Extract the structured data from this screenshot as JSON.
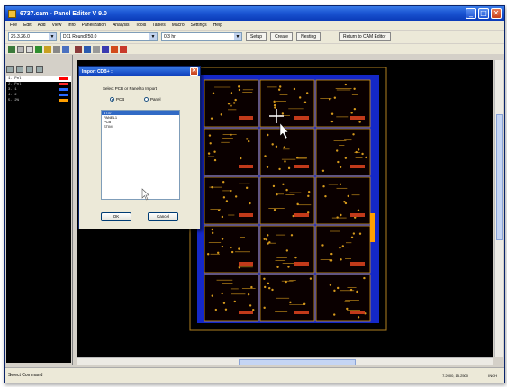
{
  "window": {
    "title": "6737.cam - Panel Editor V 9.0",
    "minimize": "_",
    "maximize": "□",
    "close": "✕"
  },
  "menu": [
    "File",
    "Edit",
    "Add",
    "View",
    "Info",
    "Panelization",
    "Analysis",
    "Tools",
    "Tables",
    "Macro",
    "Settings",
    "Help"
  ],
  "toolbar": {
    "combo1": "26.3.26.0",
    "combo2": "D11 Round250.0",
    "combo3": "0.3 hr",
    "buttons": [
      "Setup",
      "Create",
      "Nesting"
    ],
    "return_button": "Return to CAM Editor"
  },
  "layers": [
    {
      "name": "1. Pnl",
      "color": "#ff0000",
      "selected": true
    },
    {
      "name": "2. Pnl",
      "color": "#ff2a2a",
      "selected": false
    },
    {
      "name": "3. 1",
      "color": "#2a6aff",
      "selected": false
    },
    {
      "name": "4. 2",
      "color": "#2a6aff",
      "selected": false
    },
    {
      "name": "5. 2%",
      "color": "#ff9f00",
      "selected": false
    }
  ],
  "dialog": {
    "title": "Import CDB+ :",
    "prompt": "Select PCB or Panel to Import",
    "radio_pcb": "PCB",
    "radio_panel": "Panel",
    "list": [
      "6737",
      "PANEL1",
      "PCB",
      "STIM"
    ],
    "ok": "OK",
    "cancel": "Cancel"
  },
  "status": {
    "text": "Select Command",
    "coords": "7.2000, 15.2500",
    "units": "INCH"
  },
  "colors": {
    "board_blue": "#1428c8",
    "board_dark": "#0a0000",
    "trace": "#d69a1c",
    "selected_row": "#316ac5",
    "titlebar": "#1b55d3"
  }
}
